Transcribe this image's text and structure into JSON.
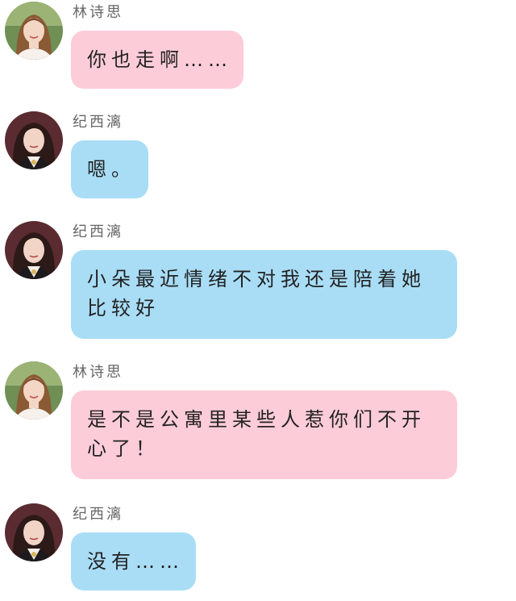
{
  "colors": {
    "pink_bubble": "#fdccd9",
    "blue_bubble": "#a9ddf6",
    "name_text": "#666666",
    "message_text": "#222222"
  },
  "messages": [
    {
      "speaker": "林诗思",
      "text": "你也走啊……",
      "bubble_color": "pink",
      "avatar": "lin-shisi-avatar"
    },
    {
      "speaker": "纪西漓",
      "text": "嗯。",
      "bubble_color": "blue",
      "avatar": "ji-xili-avatar"
    },
    {
      "speaker": "纪西漓",
      "text": "小朵最近情绪不对我还是陪着她比较好",
      "bubble_color": "blue",
      "avatar": "ji-xili-avatar"
    },
    {
      "speaker": "林诗思",
      "text": "是不是公寓里某些人惹你们不开心了！",
      "bubble_color": "pink",
      "avatar": "lin-shisi-avatar"
    },
    {
      "speaker": "纪西漓",
      "text": "没有……",
      "bubble_color": "blue",
      "avatar": "ji-xili-avatar"
    }
  ]
}
